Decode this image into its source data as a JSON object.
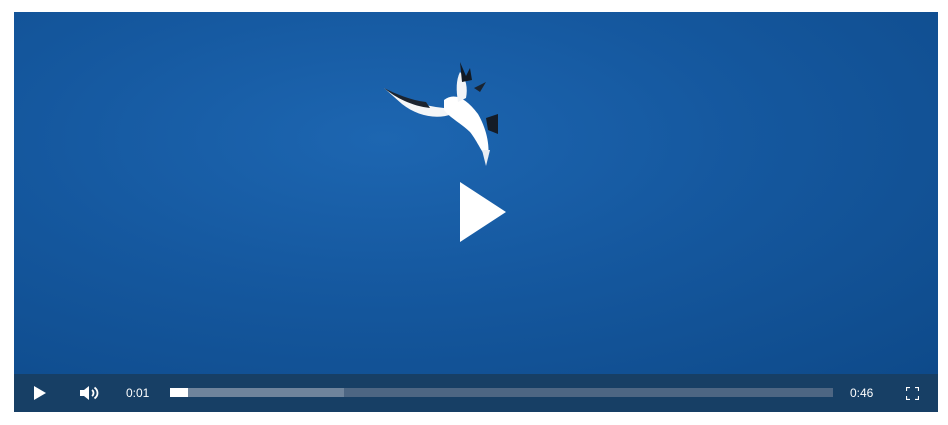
{
  "player": {
    "big_play_icon": "play-icon",
    "controls": {
      "play_icon": "play-icon",
      "volume_icon": "volume-icon",
      "fullscreen_icon": "fullscreen-icon",
      "current_time": "0:01",
      "duration": "0:46",
      "played_fraction": 0.027,
      "buffered_fraction": 0.263
    }
  },
  "colors": {
    "sky": "#15589f",
    "control_bar": "#173f65",
    "progress_track": "#4d6683",
    "progress_buffer": "#6f849c",
    "progress_played": "#ffffff"
  }
}
